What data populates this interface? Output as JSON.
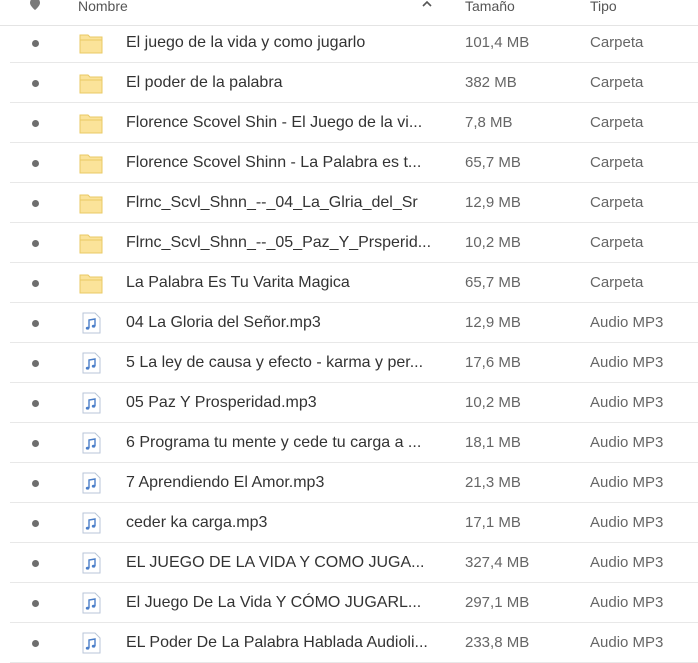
{
  "header": {
    "name_label": "Nombre",
    "size_label": "Tamaño",
    "type_label": "Tipo",
    "sort_icon": "chevron-up-icon",
    "pin_icon": "pin-icon"
  },
  "colors": {
    "folder": "#fbe39a",
    "folder_stroke": "#e9c964",
    "audio_icon": "#4a7ec9"
  },
  "files": [
    {
      "name": "El juego de la vida y como jugarlo",
      "size": "101,4 MB",
      "type": "Carpeta",
      "icon": "folder-icon"
    },
    {
      "name": "El poder de la palabra",
      "size": "382 MB",
      "type": "Carpeta",
      "icon": "folder-icon"
    },
    {
      "name": "Florence Scovel Shin - El Juego de la vi...",
      "size": "7,8 MB",
      "type": "Carpeta",
      "icon": "folder-icon"
    },
    {
      "name": "Florence Scovel Shinn - La Palabra es t...",
      "size": "65,7 MB",
      "type": "Carpeta",
      "icon": "folder-icon"
    },
    {
      "name": "Flrnc_Scvl_Shnn_--_04_La_Glria_del_Sr",
      "size": "12,9 MB",
      "type": "Carpeta",
      "icon": "folder-icon"
    },
    {
      "name": "Flrnc_Scvl_Shnn_--_05_Paz_Y_Prsperid...",
      "size": "10,2 MB",
      "type": "Carpeta",
      "icon": "folder-icon"
    },
    {
      "name": "La Palabra Es Tu Varita Magica",
      "size": "65,7 MB",
      "type": "Carpeta",
      "icon": "folder-icon"
    },
    {
      "name": "04 La Gloria del Señor.mp3",
      "size": "12,9 MB",
      "type": "Audio MP3",
      "icon": "audio-file-icon"
    },
    {
      "name": "5 La ley de causa y efecto - karma y per...",
      "size": "17,6 MB",
      "type": "Audio MP3",
      "icon": "audio-file-icon"
    },
    {
      "name": "05 Paz Y Prosperidad.mp3",
      "size": "10,2 MB",
      "type": "Audio MP3",
      "icon": "audio-file-icon"
    },
    {
      "name": "6 Programa tu mente y cede tu carga a ...",
      "size": "18,1 MB",
      "type": "Audio MP3",
      "icon": "audio-file-icon"
    },
    {
      "name": "7 Aprendiendo El Amor.mp3",
      "size": "21,3 MB",
      "type": "Audio MP3",
      "icon": "audio-file-icon"
    },
    {
      "name": "ceder ka carga.mp3",
      "size": "17,1 MB",
      "type": "Audio MP3",
      "icon": "audio-file-icon"
    },
    {
      "name": "EL JUEGO DE LA VIDA Y COMO JUGA...",
      "size": "327,4 MB",
      "type": "Audio MP3",
      "icon": "audio-file-icon"
    },
    {
      "name": "El Juego De La Vida Y CÓMO JUGARL...",
      "size": "297,1 MB",
      "type": "Audio MP3",
      "icon": "audio-file-icon"
    },
    {
      "name": "EL Poder De La Palabra Hablada Audioli...",
      "size": "233,8 MB",
      "type": "Audio MP3",
      "icon": "audio-file-icon"
    }
  ]
}
